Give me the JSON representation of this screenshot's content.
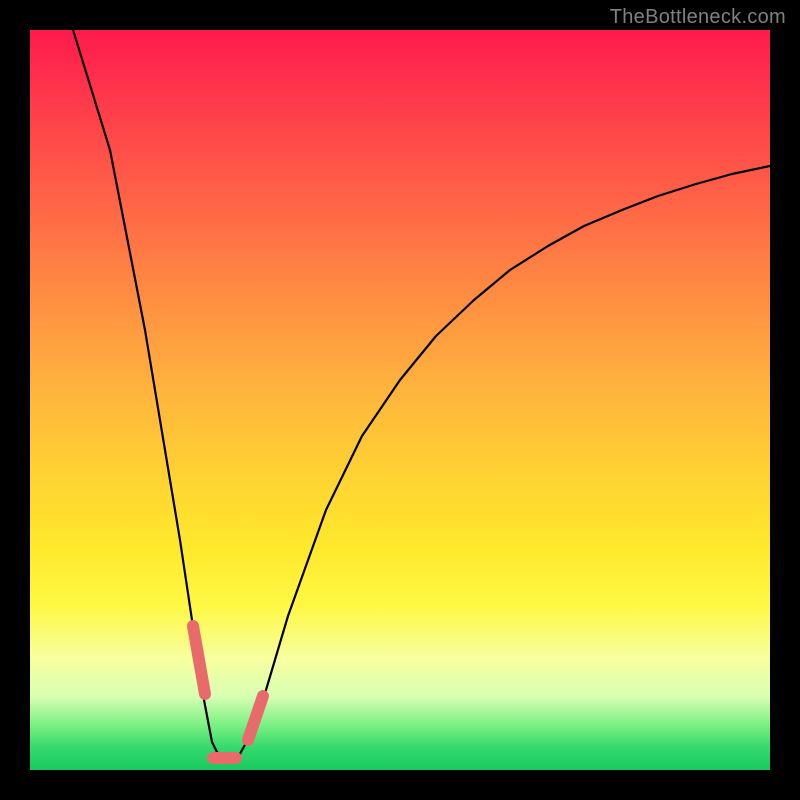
{
  "watermark": "TheBottleneck.com",
  "colors": {
    "frame": "#000000",
    "curve": "#000000",
    "marker": "#e96a6a",
    "watermark": "#808080"
  },
  "chart_data": {
    "type": "line",
    "title": "",
    "xlabel": "",
    "ylabel": "",
    "xlim": [
      0,
      100
    ],
    "ylim": [
      0,
      100
    ],
    "grid": false,
    "legend": false,
    "note": "Values read visually off the plot. y≈0 is the green bottom band; y≈100 is the red top. Curve depicts percentage mismatch (bottleneck) falling sharply to a minimum near x≈25–28 then rising and tapering toward the right.",
    "series": [
      {
        "name": "bottleneck-curve",
        "x": [
          5,
          10,
          15,
          18,
          20,
          22,
          24,
          25,
          26,
          27,
          28,
          30,
          32,
          35,
          40,
          45,
          50,
          55,
          60,
          65,
          70,
          75,
          80,
          85,
          90,
          95,
          100
        ],
        "y": [
          100,
          82,
          58,
          42,
          30,
          18,
          7,
          2,
          0,
          0,
          1,
          5,
          12,
          22,
          36,
          46,
          54,
          60,
          65,
          69,
          72,
          75,
          77,
          79,
          81,
          82,
          83
        ]
      }
    ],
    "markers": [
      {
        "name": "left-descent-segment",
        "x_range": [
          22.0,
          23.5
        ],
        "y_range": [
          11,
          18
        ]
      },
      {
        "name": "valley-bottom-segment",
        "x_range": [
          24.5,
          27.5
        ],
        "y_range": [
          0,
          1
        ]
      },
      {
        "name": "right-ascent-segment",
        "x_range": [
          29.5,
          31.5
        ],
        "y_range": [
          4,
          10
        ]
      }
    ]
  }
}
